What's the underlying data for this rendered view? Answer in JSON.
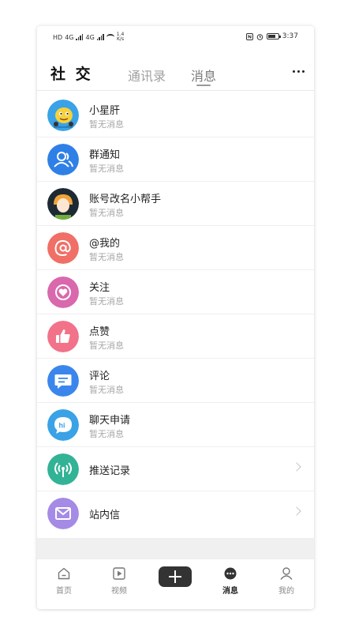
{
  "status_bar": {
    "left_label": "HD",
    "signal_1_label": "4G",
    "signal_2_label": "4G",
    "net_speed_value": "1.4",
    "net_speed_unit": "K/s",
    "time": "3:37",
    "icons": [
      "nfc-icon",
      "alarm-icon",
      "battery-icon"
    ]
  },
  "header": {
    "title": "社 交",
    "tabs": [
      {
        "label": "通讯录",
        "active": false
      },
      {
        "label": "消息",
        "active": true
      }
    ],
    "more_icon": "more-icon"
  },
  "list": {
    "items": [
      {
        "title": "小星肝",
        "subtitle": "暂无消息",
        "icon": "cartoon-avatar-icon",
        "color": "#3aa2e6"
      },
      {
        "title": "群通知",
        "subtitle": "暂无消息",
        "icon": "group-icon",
        "color": "#2f80e6"
      },
      {
        "title": "账号改名小帮手",
        "subtitle": "暂无消息",
        "icon": "helper-avatar-icon",
        "color": "#1e2a33"
      },
      {
        "title": "@我的",
        "subtitle": "暂无消息",
        "icon": "at-icon",
        "color": "#f06f66"
      },
      {
        "title": "关注",
        "subtitle": "暂无消息",
        "icon": "heart-icon",
        "color": "#d968ad"
      },
      {
        "title": "点赞",
        "subtitle": "暂无消息",
        "icon": "thumbs-up-icon",
        "color": "#f2728a"
      },
      {
        "title": "评论",
        "subtitle": "暂无消息",
        "icon": "comment-icon",
        "color": "#3b86ec"
      },
      {
        "title": "聊天申请",
        "subtitle": "暂无消息",
        "icon": "hi-chat-icon",
        "color": "#3aa2e6"
      },
      {
        "title": "推送记录",
        "icon": "broadcast-icon",
        "color": "#32b396",
        "chevron": true
      },
      {
        "title": "站内信",
        "icon": "mail-icon",
        "color": "#a58ae6",
        "chevron": true
      }
    ]
  },
  "bottom_nav": {
    "items": [
      {
        "label": "首页",
        "icon": "home-icon",
        "active": false
      },
      {
        "label": "视频",
        "icon": "video-icon",
        "active": false
      },
      {
        "label": "消息",
        "icon": "message-icon",
        "active": true
      },
      {
        "label": "我的",
        "icon": "profile-icon",
        "active": false
      }
    ],
    "plus_icon": "plus-icon"
  }
}
